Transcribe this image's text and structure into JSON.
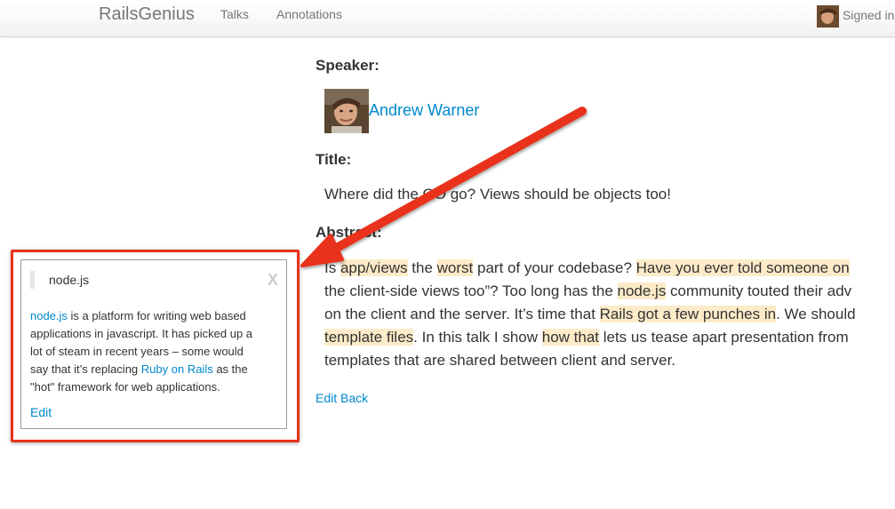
{
  "navbar": {
    "brand": "RailsGenius",
    "links": [
      "Talks",
      "Annotations"
    ],
    "user_text": "Signed in"
  },
  "talk": {
    "speaker_label": "Speaker:",
    "speaker_name": "Andrew Warner",
    "title_label": "Title:",
    "title": "Where did the OO go? Views should be objects too!",
    "abstract_label": "Abstract:",
    "abstract_lines": [
      [
        {
          "text": "Is ",
          "highlight": false
        },
        {
          "text": "app/views",
          "highlight": true
        },
        {
          "text": " the ",
          "highlight": false
        },
        {
          "text": "worst",
          "highlight": true
        },
        {
          "text": " part of your codebase? ",
          "highlight": false
        },
        {
          "text": "Have you ever told someone on",
          "highlight": true
        }
      ],
      [
        {
          "text": "the client-side views too”? Too long has the ",
          "highlight": false
        },
        {
          "text": "node.js",
          "highlight": true
        },
        {
          "text": " community touted their adv",
          "highlight": false
        }
      ],
      [
        {
          "text": "on the client and the server. It’s time that ",
          "highlight": false
        },
        {
          "text": "Rails got a few punches in",
          "highlight": true
        },
        {
          "text": ". We should",
          "highlight": false
        }
      ],
      [
        {
          "text": "template files",
          "highlight": true
        },
        {
          "text": ". In this talk I show ",
          "highlight": false
        },
        {
          "text": "how that",
          "highlight": true
        },
        {
          "text": " lets us tease apart presentation from",
          "highlight": false
        }
      ],
      [
        {
          "text": "templates that are shared between client and server.",
          "highlight": false
        }
      ]
    ],
    "actions": [
      "Edit",
      "Back"
    ]
  },
  "annotation": {
    "title": "node.js",
    "close": "X",
    "body_lines": [
      [
        {
          "text": "node.js",
          "link": true
        },
        {
          "text": " is a platform for writing web based",
          "link": false
        }
      ],
      [
        {
          "text": "applications in javascript. It has picked up a",
          "link": false
        }
      ],
      [
        {
          "text": "lot of steam in recent years – some would",
          "link": false
        }
      ],
      [
        {
          "text": "say that it’s replacing ",
          "link": false
        },
        {
          "text": "Ruby on Rails",
          "link": true
        },
        {
          "text": " as the",
          "link": false
        }
      ],
      [
        {
          "text": "\"hot\" framework for web applications.",
          "link": false
        }
      ]
    ],
    "edit": "Edit"
  },
  "colors": {
    "link": "#0088cc",
    "highlight": "#fcebc8",
    "annotation_frame": "#e8321c"
  }
}
